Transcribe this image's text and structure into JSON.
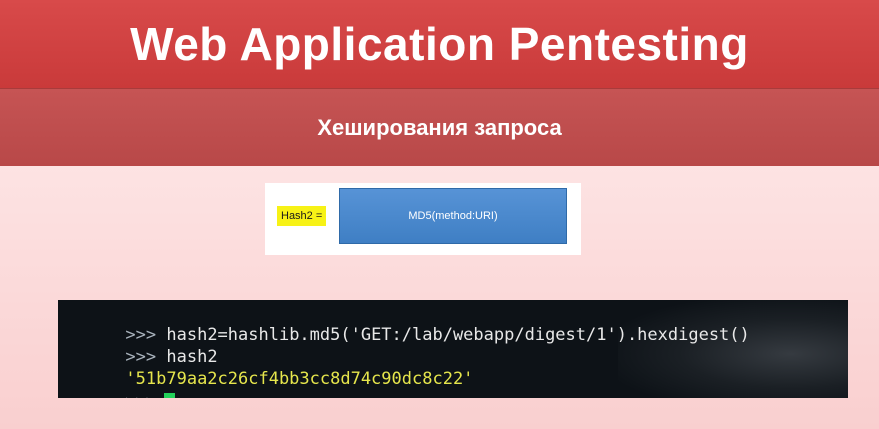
{
  "title": "Web Application Pentesting",
  "subtitle": "Хеширования запроса",
  "diagram": {
    "label": "Hash2 =",
    "box_text": "MD5(method:URI)"
  },
  "terminal": {
    "lines": [
      {
        "prompt": ">>>",
        "text": " hash2=hashlib.md5('GET:/lab/webapp/digest/1').hexdigest()"
      },
      {
        "prompt": ">>>",
        "text": " hash2"
      },
      {
        "output": "'51b79aa2c26cf4bb3cc8d74c90dc8c22'"
      },
      {
        "prompt": ">>>",
        "text": ""
      }
    ]
  },
  "colors": {
    "title_bar": "#d84a4a",
    "subtitle_bar": "#c65454",
    "content_bg": "#fde1e1",
    "md5_box": "#4a8ad0",
    "highlight": "#f7f216",
    "terminal_bg": "#0d1217",
    "output_text": "#e6e64c",
    "cursor": "#22d15a"
  }
}
